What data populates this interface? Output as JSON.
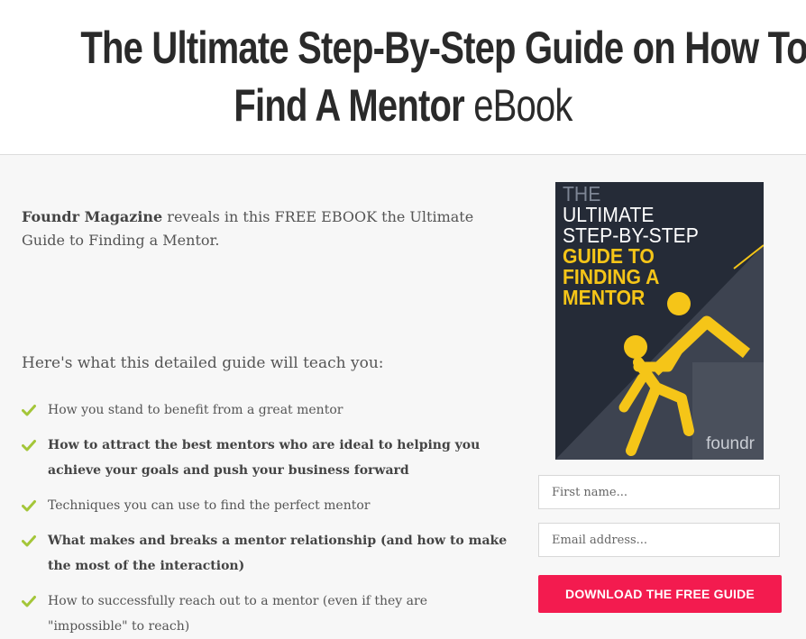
{
  "header": {
    "title_line1": "The Ultimate Step-By-Step Guide on How To",
    "title_bold": "Find A Mentor",
    "title_suffix": " eBook"
  },
  "intro": {
    "brand": "Foundr Magazine",
    "text": " reveals in this FREE EBOOK the Ultimate Guide to Finding a Mentor."
  },
  "lead": "Here's what this detailed guide will teach you:",
  "benefits": [
    {
      "text": "How you stand to benefit from a great mentor",
      "bold": false
    },
    {
      "text": "How to attract the best mentors who are ideal to helping you achieve your goals and push your business forward",
      "bold": true
    },
    {
      "text": "Techniques you can use to find the perfect mentor",
      "bold": false
    },
    {
      "text": "What makes and breaks a mentor relationship (and how to make the most of the interaction)",
      "bold": true
    },
    {
      "text": "How to successfully reach out to a mentor (even if they are \"impossible\" to reach)",
      "bold": false
    }
  ],
  "cover": {
    "line_the": "THE",
    "line_ultimate": "ULTIMATE",
    "line_step": "STEP-BY-STEP",
    "line_guide": "GUIDE TO",
    "line_finding": "FINDING A",
    "line_mentor": "MENTOR",
    "logo": "foundr"
  },
  "form": {
    "first_name_placeholder": "First name...",
    "email_placeholder": "Email address...",
    "button_label": "DOWNLOAD THE FREE GUIDE"
  },
  "colors": {
    "accent": "#f31b4f",
    "check": "#a4c639",
    "cover_bg": "#252b37",
    "cover_yellow": "#f5c518"
  },
  "icons": {
    "check": "check-icon",
    "climber": "climber-illustration"
  }
}
